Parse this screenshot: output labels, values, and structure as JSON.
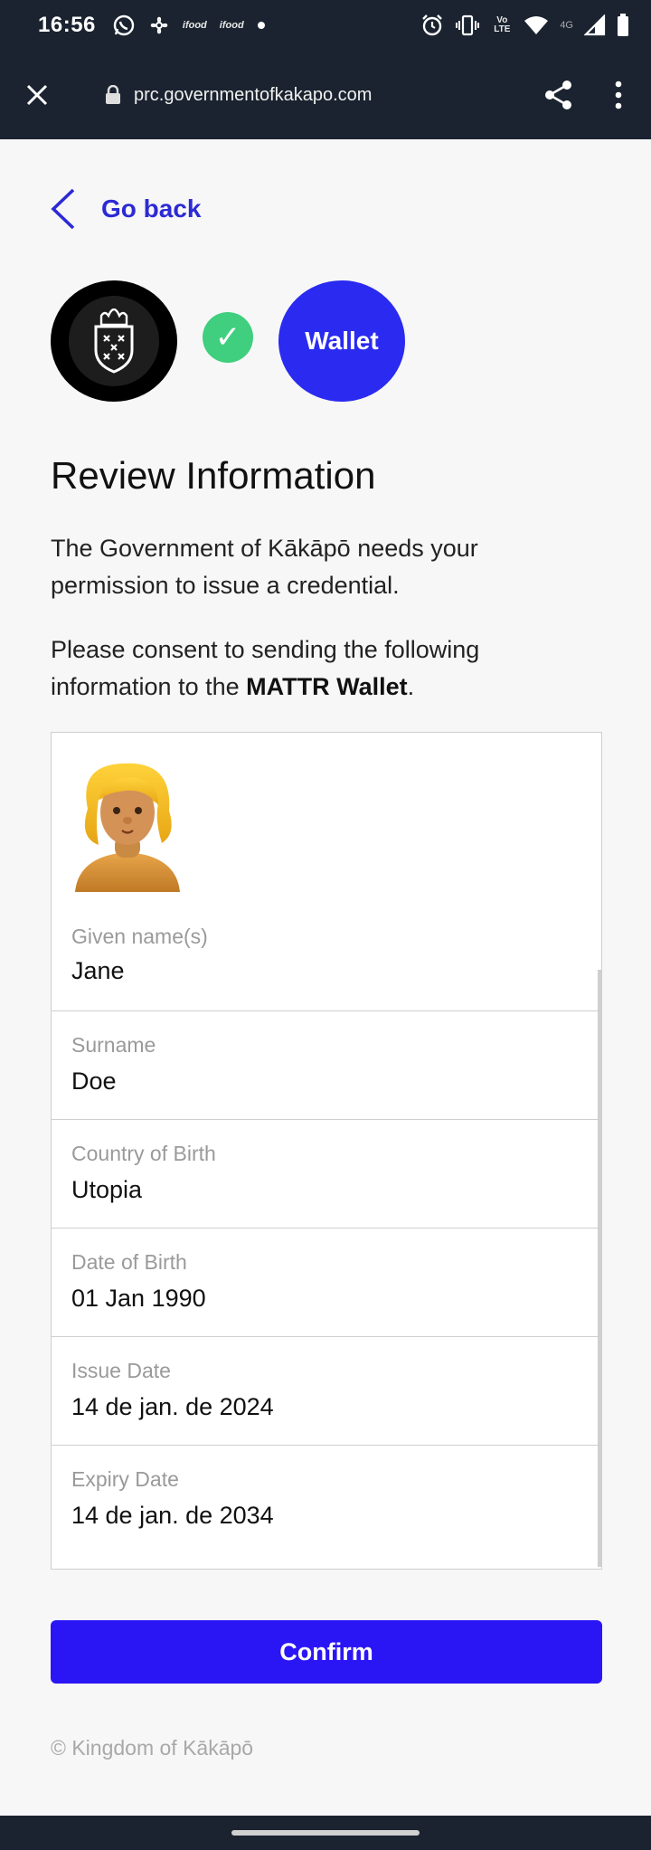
{
  "status_bar": {
    "time": "16:56",
    "notification_icons": [
      "whatsapp-icon",
      "fan-icon",
      "ifood-icon",
      "ifood-icon",
      "dot-icon"
    ],
    "ifood_label": "ifood",
    "right_icons": [
      "alarm-icon",
      "vibrate-icon",
      "volte-icon",
      "wifi-icon",
      "signal-4g-icon",
      "cell-signal-icon",
      "battery-icon"
    ],
    "volte_label": "Vo LTE",
    "network_label": "4G"
  },
  "browser": {
    "url": "prc.governmentofkakapo.com"
  },
  "nav": {
    "go_back_label": "Go back"
  },
  "logos": {
    "check_symbol": "✓",
    "wallet_label": "Wallet"
  },
  "main": {
    "title": "Review Information",
    "paragraph1": "The Government of Kākāpō needs your permission to issue a credential.",
    "paragraph2_prefix": "Please consent to sending the following information to the ",
    "paragraph2_bold": "MATTR Wallet",
    "paragraph2_suffix": "."
  },
  "credential": {
    "fields": [
      {
        "label": "Given name(s)",
        "value": "Jane"
      },
      {
        "label": "Surname",
        "value": "Doe"
      },
      {
        "label": "Country of Birth",
        "value": "Utopia"
      },
      {
        "label": "Date of Birth",
        "value": "01 Jan 1990"
      },
      {
        "label": "Issue Date",
        "value": "14 de jan. de 2024"
      },
      {
        "label": "Expiry Date",
        "value": "14 de jan. de 2034"
      }
    ]
  },
  "actions": {
    "confirm_label": "Confirm"
  },
  "footer": {
    "text": "© Kingdom of Kākāpō"
  },
  "colors": {
    "accent": "#2a16f5",
    "link": "#2c2ad4",
    "success": "#3fcf7e",
    "wallet": "#2a2af0",
    "chrome": "#1b2330"
  }
}
